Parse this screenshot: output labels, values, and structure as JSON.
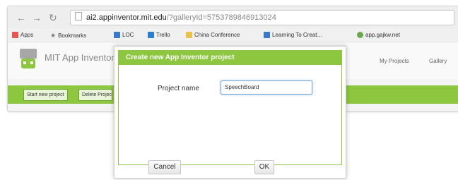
{
  "browser": {
    "url_host": "ai2.appinventor.mit.edu",
    "url_path": "/?galleryId=5753789846913024",
    "bookmarks": [
      {
        "label": "Apps",
        "icon": "apps-grid-icon",
        "color": "#e8554e"
      },
      {
        "label": "Bookmarks",
        "icon": "star-icon",
        "color": "#777777"
      },
      {
        "label": "LOC",
        "icon": "bookmark-icon",
        "color": "#3a78c9"
      },
      {
        "label": "Trello",
        "icon": "trello-icon",
        "color": "#2a7fd1"
      },
      {
        "label": "China Conference",
        "icon": "folder-icon",
        "color": "#e9c24a"
      },
      {
        "label": "Learning To Creat…",
        "icon": "bookmark-icon",
        "color": "#3a78c9"
      },
      {
        "label": "app.gajkw.net",
        "icon": "globe-icon",
        "color": "#6aa84f"
      }
    ]
  },
  "app": {
    "title": "MIT App Inventor",
    "nav": [
      "My Projects",
      "Gallery"
    ],
    "toolbar": [
      "Start new project",
      "Delete Project"
    ]
  },
  "dialog": {
    "title": "Create new App Inventor project",
    "field_label": "Project name",
    "field_value": "SpeechBoard",
    "cancel_label": "Cancel",
    "ok_label": "OK"
  },
  "colors": {
    "accent": "#8dc63f",
    "focus": "#7da7d9"
  }
}
